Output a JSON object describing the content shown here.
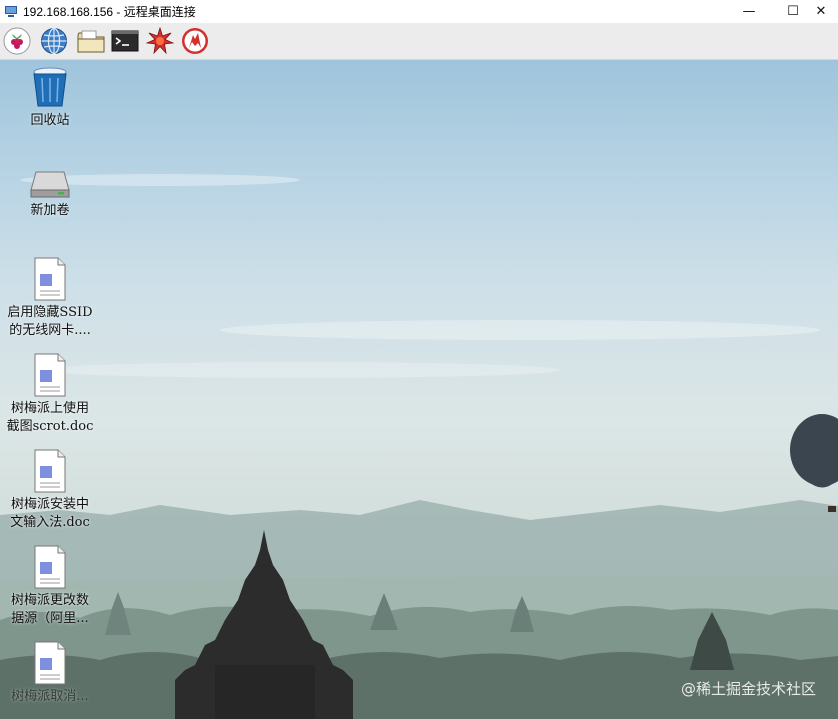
{
  "window": {
    "title": "192.168.168.156 - 远程桌面连接",
    "min_glyph": "—",
    "max_glyph": "☐",
    "close_glyph": "✕"
  },
  "panel": {
    "launchers": [
      {
        "icon": "raspberry-menu-icon"
      },
      {
        "icon": "web-browser-icon"
      },
      {
        "icon": "file-manager-icon"
      },
      {
        "icon": "terminal-icon"
      },
      {
        "icon": "mathematica-icon"
      },
      {
        "icon": "wolfram-icon"
      }
    ]
  },
  "desktop": {
    "icons": [
      {
        "name": "recycle-bin",
        "icon": "trash-icon",
        "label": "回收站"
      },
      {
        "name": "new-volume",
        "icon": "drive-icon",
        "label": "新加卷"
      },
      {
        "name": "doc-ssid",
        "icon": "document-icon",
        "label": "启用隐藏SSID\n的无线网卡...."
      },
      {
        "name": "doc-scrot",
        "icon": "document-icon",
        "label": "树梅派上使用\n截图scrot.doc"
      },
      {
        "name": "doc-ime",
        "icon": "document-icon",
        "label": "树梅派安装中\n文输入法.doc"
      },
      {
        "name": "doc-source",
        "icon": "document-icon",
        "label": "树梅派更改数\n据源（阿里..."
      },
      {
        "name": "doc-partial",
        "icon": "document-icon",
        "label": "树梅派取消..."
      }
    ]
  },
  "watermark": "@稀土掘金技术社区"
}
